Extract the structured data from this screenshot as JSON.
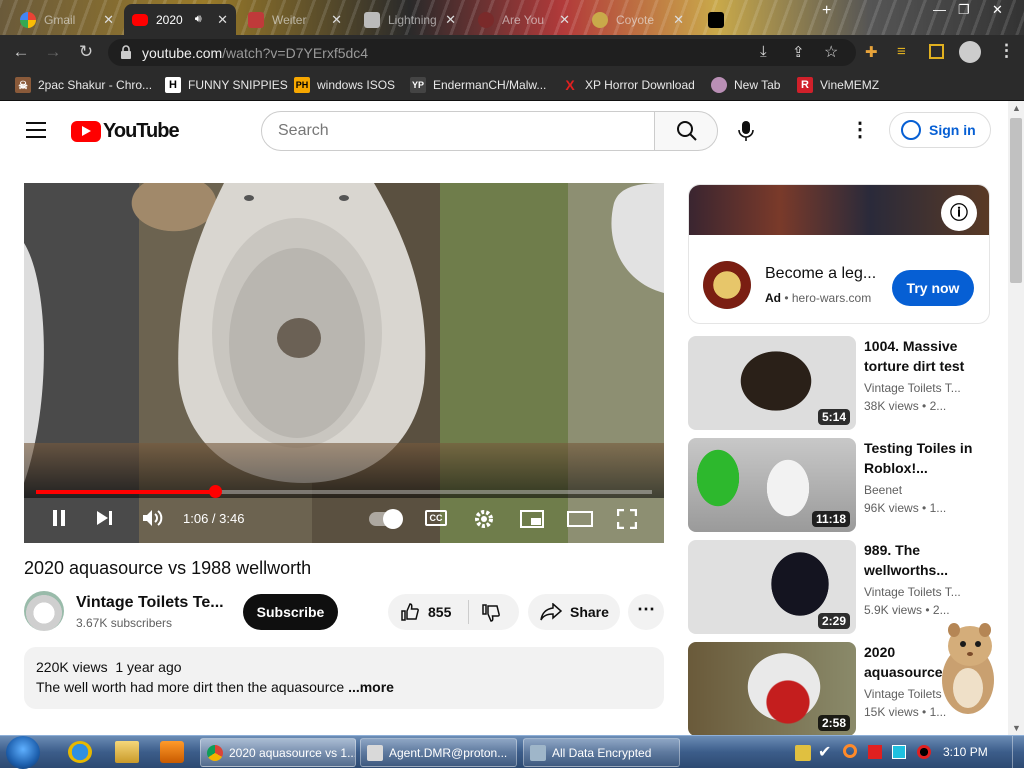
{
  "browser": {
    "tabs": [
      {
        "title": "Gmail",
        "active": false
      },
      {
        "title": "2020",
        "active": true
      },
      {
        "title": "Weiter",
        "active": false
      },
      {
        "title": "Lightning",
        "active": false
      },
      {
        "title": "Are You",
        "active": false
      },
      {
        "title": "Coyote",
        "active": false
      }
    ],
    "url_host": "youtube.com",
    "url_path": "/watch?v=D7YErxf5dc4",
    "bookmarks": [
      {
        "label": "2pac Shakur - Chro...",
        "icon": "skull",
        "color": "#8a5a3a"
      },
      {
        "label": "FUNNY SNIPPIES",
        "icon": "H",
        "color": "#222222"
      },
      {
        "label": "windows ISOS",
        "icon": "PH",
        "color": "#f7a700"
      },
      {
        "label": "EndermanCH/Malw...",
        "icon": "YP",
        "color": "#333333"
      },
      {
        "label": "XP Horror Download",
        "icon": "X",
        "color": "#e02020"
      },
      {
        "label": "New Tab",
        "icon": "globe",
        "color": "#b98fb5"
      },
      {
        "label": "VineMEMZ",
        "icon": "R",
        "color": "#d0202a"
      }
    ]
  },
  "youtube": {
    "logo_text": "YouTube",
    "search_placeholder": "Search",
    "sign_in": "Sign in",
    "player": {
      "time": "1:06 / 3:46",
      "progress": 0.29
    },
    "video": {
      "title": "2020 aquasource vs 1988 wellworth",
      "channel": "Vintage Toilets Te...",
      "subscribers": "3.67K subscribers",
      "subscribe_label": "Subscribe",
      "likes": "855",
      "share_label": "Share",
      "views": "220K views",
      "age": "1 year ago",
      "description": "The well worth had more dirt then the aquasource",
      "more_label": "...more"
    },
    "ad": {
      "title": "Become a leg...",
      "ad_label": "Ad",
      "domain": "hero-wars.com",
      "cta": "Try now"
    },
    "recommendations": [
      {
        "title": "1004. Massive torture dirt test",
        "channel": "Vintage Toilets T...",
        "views": "38K views",
        "age": "• 2...",
        "duration": "5:14"
      },
      {
        "title": "Testing Toiles in Roblox!...",
        "channel": "Beenet",
        "views": "96K views",
        "age": "• 1...",
        "duration": "11:18"
      },
      {
        "title": "989. The wellworths...",
        "channel": "Vintage Toilets T...",
        "views": "5.9K views",
        "age": "• 2...",
        "duration": "2:29"
      },
      {
        "title": "2020 aquasource...",
        "channel": "Vintage Toilets",
        "views": "15K views",
        "age": "• 1...",
        "duration": "2:58"
      }
    ]
  },
  "taskbar": {
    "buttons": [
      {
        "label": "2020 aquasource vs 1...",
        "active": true
      },
      {
        "label": "Agent.DMR@proton...",
        "active": false
      },
      {
        "label": "All Data Encrypted",
        "active": false
      }
    ],
    "clock": "3:10 PM"
  }
}
